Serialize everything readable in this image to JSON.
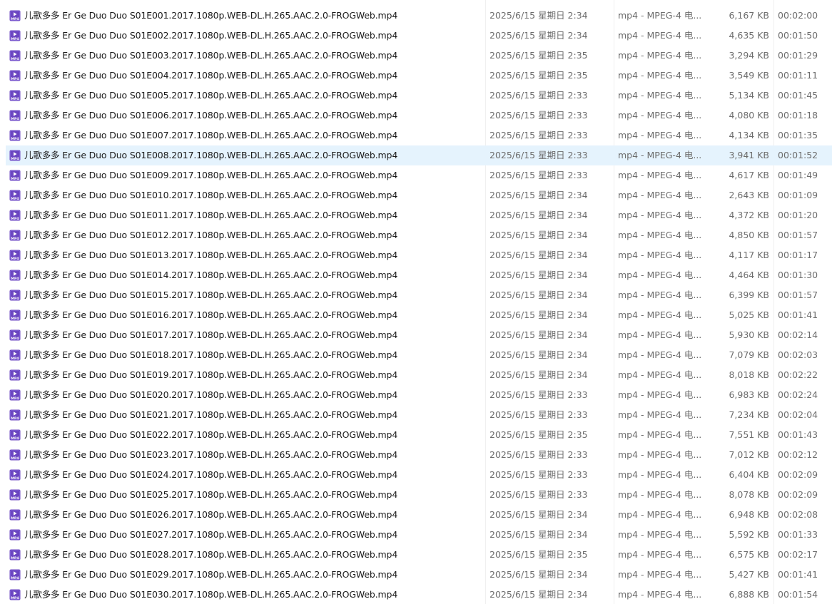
{
  "files": [
    {
      "name": "儿歌多多 Er Ge Duo Duo S01E001.2017.1080p.WEB-DL.H.265.AAC.2.0-FROGWeb.mp4",
      "date": "2025/6/15 星期日 2:34",
      "type": "mp4 - MPEG-4 电...",
      "size": "6,167 KB",
      "duration": "00:02:00"
    },
    {
      "name": "儿歌多多 Er Ge Duo Duo S01E002.2017.1080p.WEB-DL.H.265.AAC.2.0-FROGWeb.mp4",
      "date": "2025/6/15 星期日 2:34",
      "type": "mp4 - MPEG-4 电...",
      "size": "4,635 KB",
      "duration": "00:01:50"
    },
    {
      "name": "儿歌多多 Er Ge Duo Duo S01E003.2017.1080p.WEB-DL.H.265.AAC.2.0-FROGWeb.mp4",
      "date": "2025/6/15 星期日 2:35",
      "type": "mp4 - MPEG-4 电...",
      "size": "3,294 KB",
      "duration": "00:01:29"
    },
    {
      "name": "儿歌多多 Er Ge Duo Duo S01E004.2017.1080p.WEB-DL.H.265.AAC.2.0-FROGWeb.mp4",
      "date": "2025/6/15 星期日 2:35",
      "type": "mp4 - MPEG-4 电...",
      "size": "3,549 KB",
      "duration": "00:01:11"
    },
    {
      "name": "儿歌多多 Er Ge Duo Duo S01E005.2017.1080p.WEB-DL.H.265.AAC.2.0-FROGWeb.mp4",
      "date": "2025/6/15 星期日 2:33",
      "type": "mp4 - MPEG-4 电...",
      "size": "5,134 KB",
      "duration": "00:01:45"
    },
    {
      "name": "儿歌多多 Er Ge Duo Duo S01E006.2017.1080p.WEB-DL.H.265.AAC.2.0-FROGWeb.mp4",
      "date": "2025/6/15 星期日 2:33",
      "type": "mp4 - MPEG-4 电...",
      "size": "4,080 KB",
      "duration": "00:01:18"
    },
    {
      "name": "儿歌多多 Er Ge Duo Duo S01E007.2017.1080p.WEB-DL.H.265.AAC.2.0-FROGWeb.mp4",
      "date": "2025/6/15 星期日 2:33",
      "type": "mp4 - MPEG-4 电...",
      "size": "4,134 KB",
      "duration": "00:01:35"
    },
    {
      "name": "儿歌多多 Er Ge Duo Duo S01E008.2017.1080p.WEB-DL.H.265.AAC.2.0-FROGWeb.mp4",
      "date": "2025/6/15 星期日 2:33",
      "type": "mp4 - MPEG-4 电...",
      "size": "3,941 KB",
      "duration": "00:01:52",
      "selected": true
    },
    {
      "name": "儿歌多多 Er Ge Duo Duo S01E009.2017.1080p.WEB-DL.H.265.AAC.2.0-FROGWeb.mp4",
      "date": "2025/6/15 星期日 2:33",
      "type": "mp4 - MPEG-4 电...",
      "size": "4,617 KB",
      "duration": "00:01:49"
    },
    {
      "name": "儿歌多多 Er Ge Duo Duo S01E010.2017.1080p.WEB-DL.H.265.AAC.2.0-FROGWeb.mp4",
      "date": "2025/6/15 星期日 2:34",
      "type": "mp4 - MPEG-4 电...",
      "size": "2,643 KB",
      "duration": "00:01:09"
    },
    {
      "name": "儿歌多多 Er Ge Duo Duo S01E011.2017.1080p.WEB-DL.H.265.AAC.2.0-FROGWeb.mp4",
      "date": "2025/6/15 星期日 2:34",
      "type": "mp4 - MPEG-4 电...",
      "size": "4,372 KB",
      "duration": "00:01:20"
    },
    {
      "name": "儿歌多多 Er Ge Duo Duo S01E012.2017.1080p.WEB-DL.H.265.AAC.2.0-FROGWeb.mp4",
      "date": "2025/6/15 星期日 2:34",
      "type": "mp4 - MPEG-4 电...",
      "size": "4,850 KB",
      "duration": "00:01:57"
    },
    {
      "name": "儿歌多多 Er Ge Duo Duo S01E013.2017.1080p.WEB-DL.H.265.AAC.2.0-FROGWeb.mp4",
      "date": "2025/6/15 星期日 2:34",
      "type": "mp4 - MPEG-4 电...",
      "size": "4,117 KB",
      "duration": "00:01:17"
    },
    {
      "name": "儿歌多多 Er Ge Duo Duo S01E014.2017.1080p.WEB-DL.H.265.AAC.2.0-FROGWeb.mp4",
      "date": "2025/6/15 星期日 2:34",
      "type": "mp4 - MPEG-4 电...",
      "size": "4,464 KB",
      "duration": "00:01:30"
    },
    {
      "name": "儿歌多多 Er Ge Duo Duo S01E015.2017.1080p.WEB-DL.H.265.AAC.2.0-FROGWeb.mp4",
      "date": "2025/6/15 星期日 2:34",
      "type": "mp4 - MPEG-4 电...",
      "size": "6,399 KB",
      "duration": "00:01:57"
    },
    {
      "name": "儿歌多多 Er Ge Duo Duo S01E016.2017.1080p.WEB-DL.H.265.AAC.2.0-FROGWeb.mp4",
      "date": "2025/6/15 星期日 2:34",
      "type": "mp4 - MPEG-4 电...",
      "size": "5,025 KB",
      "duration": "00:01:41"
    },
    {
      "name": "儿歌多多 Er Ge Duo Duo S01E017.2017.1080p.WEB-DL.H.265.AAC.2.0-FROGWeb.mp4",
      "date": "2025/6/15 星期日 2:34",
      "type": "mp4 - MPEG-4 电...",
      "size": "5,930 KB",
      "duration": "00:02:14"
    },
    {
      "name": "儿歌多多 Er Ge Duo Duo S01E018.2017.1080p.WEB-DL.H.265.AAC.2.0-FROGWeb.mp4",
      "date": "2025/6/15 星期日 2:34",
      "type": "mp4 - MPEG-4 电...",
      "size": "7,079 KB",
      "duration": "00:02:03"
    },
    {
      "name": "儿歌多多 Er Ge Duo Duo S01E019.2017.1080p.WEB-DL.H.265.AAC.2.0-FROGWeb.mp4",
      "date": "2025/6/15 星期日 2:34",
      "type": "mp4 - MPEG-4 电...",
      "size": "8,018 KB",
      "duration": "00:02:22"
    },
    {
      "name": "儿歌多多 Er Ge Duo Duo S01E020.2017.1080p.WEB-DL.H.265.AAC.2.0-FROGWeb.mp4",
      "date": "2025/6/15 星期日 2:33",
      "type": "mp4 - MPEG-4 电...",
      "size": "6,983 KB",
      "duration": "00:02:24"
    },
    {
      "name": "儿歌多多 Er Ge Duo Duo S01E021.2017.1080p.WEB-DL.H.265.AAC.2.0-FROGWeb.mp4",
      "date": "2025/6/15 星期日 2:33",
      "type": "mp4 - MPEG-4 电...",
      "size": "7,234 KB",
      "duration": "00:02:04"
    },
    {
      "name": "儿歌多多 Er Ge Duo Duo S01E022.2017.1080p.WEB-DL.H.265.AAC.2.0-FROGWeb.mp4",
      "date": "2025/6/15 星期日 2:35",
      "type": "mp4 - MPEG-4 电...",
      "size": "7,551 KB",
      "duration": "00:01:43"
    },
    {
      "name": "儿歌多多 Er Ge Duo Duo S01E023.2017.1080p.WEB-DL.H.265.AAC.2.0-FROGWeb.mp4",
      "date": "2025/6/15 星期日 2:33",
      "type": "mp4 - MPEG-4 电...",
      "size": "7,012 KB",
      "duration": "00:02:12"
    },
    {
      "name": "儿歌多多 Er Ge Duo Duo S01E024.2017.1080p.WEB-DL.H.265.AAC.2.0-FROGWeb.mp4",
      "date": "2025/6/15 星期日 2:33",
      "type": "mp4 - MPEG-4 电...",
      "size": "6,404 KB",
      "duration": "00:02:09"
    },
    {
      "name": "儿歌多多 Er Ge Duo Duo S01E025.2017.1080p.WEB-DL.H.265.AAC.2.0-FROGWeb.mp4",
      "date": "2025/6/15 星期日 2:33",
      "type": "mp4 - MPEG-4 电...",
      "size": "8,078 KB",
      "duration": "00:02:09"
    },
    {
      "name": "儿歌多多 Er Ge Duo Duo S01E026.2017.1080p.WEB-DL.H.265.AAC.2.0-FROGWeb.mp4",
      "date": "2025/6/15 星期日 2:34",
      "type": "mp4 - MPEG-4 电...",
      "size": "6,948 KB",
      "duration": "00:02:08"
    },
    {
      "name": "儿歌多多 Er Ge Duo Duo S01E027.2017.1080p.WEB-DL.H.265.AAC.2.0-FROGWeb.mp4",
      "date": "2025/6/15 星期日 2:34",
      "type": "mp4 - MPEG-4 电...",
      "size": "5,592 KB",
      "duration": "00:01:33"
    },
    {
      "name": "儿歌多多 Er Ge Duo Duo S01E028.2017.1080p.WEB-DL.H.265.AAC.2.0-FROGWeb.mp4",
      "date": "2025/6/15 星期日 2:35",
      "type": "mp4 - MPEG-4 电...",
      "size": "6,575 KB",
      "duration": "00:02:17"
    },
    {
      "name": "儿歌多多 Er Ge Duo Duo S01E029.2017.1080p.WEB-DL.H.265.AAC.2.0-FROGWeb.mp4",
      "date": "2025/6/15 星期日 2:34",
      "type": "mp4 - MPEG-4 电...",
      "size": "5,427 KB",
      "duration": "00:01:41"
    },
    {
      "name": "儿歌多多 Er Ge Duo Duo S01E030.2017.1080p.WEB-DL.H.265.AAC.2.0-FROGWeb.mp4",
      "date": "2025/6/15 星期日 2:34",
      "type": "mp4 - MPEG-4 电...",
      "size": "6,888 KB",
      "duration": "00:01:54"
    }
  ],
  "icons": {
    "file_icon": "mp4-file-icon",
    "icon_label": "MP4"
  },
  "colors": {
    "selected_row": "#e5f3fd",
    "icon_purple": "#6b46c1",
    "secondary_text": "#6d6d6d"
  }
}
